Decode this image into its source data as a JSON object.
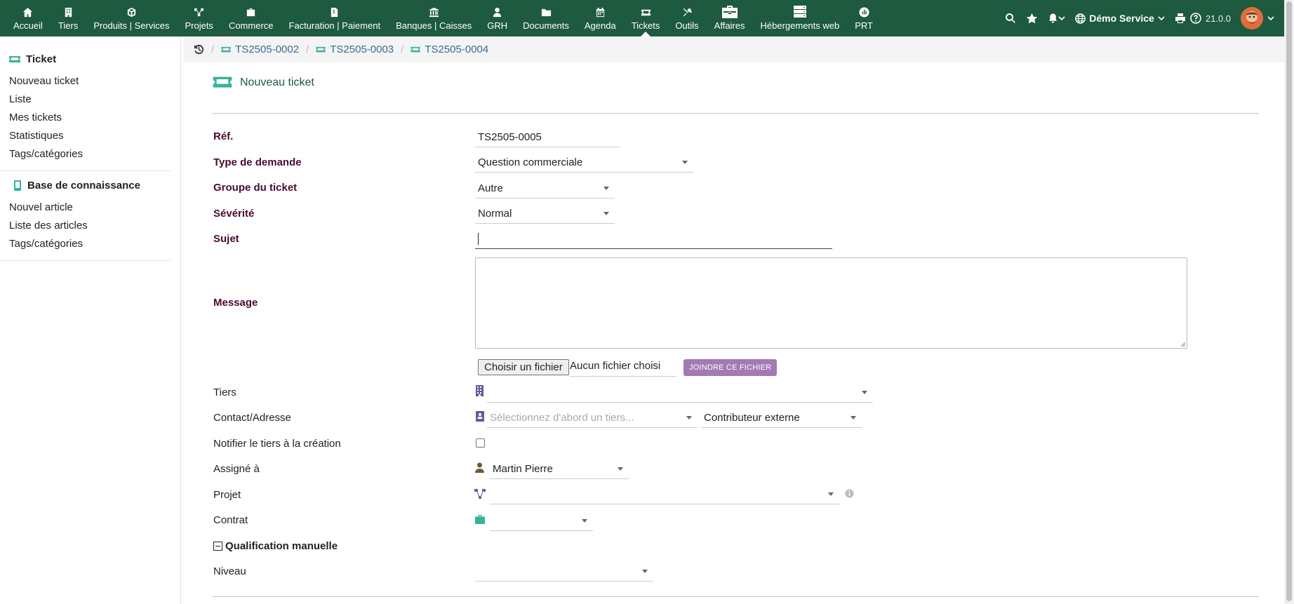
{
  "topbar": {
    "menu": [
      {
        "label": "Accueil",
        "icon": "home-icon"
      },
      {
        "label": "Tiers",
        "icon": "building-icon"
      },
      {
        "label": "Produits | Services",
        "icon": "cube-icon"
      },
      {
        "label": "Projets",
        "icon": "project-icon"
      },
      {
        "label": "Commerce",
        "icon": "briefcase-icon"
      },
      {
        "label": "Facturation | Paiement",
        "icon": "invoice-icon"
      },
      {
        "label": "Banques | Caisses",
        "icon": "bank-icon"
      },
      {
        "label": "GRH",
        "icon": "user-tie-icon"
      },
      {
        "label": "Documents",
        "icon": "folder-icon"
      },
      {
        "label": "Agenda",
        "icon": "calendar-icon"
      },
      {
        "label": "Tickets",
        "icon": "ticket-icon"
      },
      {
        "label": "Outils",
        "icon": "tools-icon"
      },
      {
        "label": "Affaires",
        "icon": "toolbox-icon"
      },
      {
        "label": "Hébergements web",
        "icon": "server-icon"
      },
      {
        "label": "PRT",
        "icon": "chart-circle-icon"
      }
    ],
    "active": "Tickets",
    "company": "Démo Service",
    "version": "21.0.0"
  },
  "breadcrumb": [
    "TS2505-0002",
    "TS2505-0003",
    "TS2505-0004"
  ],
  "sidebar": {
    "ticket_title": "Ticket",
    "ticket_links": [
      "Nouveau ticket",
      "Liste",
      "Mes tickets",
      "Statistiques",
      "Tags/catégories"
    ],
    "kb_title": "Base de connaissance",
    "kb_links": [
      "Nouvel article",
      "Liste des articles",
      "Tags/catégories"
    ]
  },
  "page": {
    "title": "Nouveau ticket"
  },
  "form": {
    "ref_label": "Réf.",
    "ref_value": "TS2505-0005",
    "type_label": "Type de demande",
    "type_value": "Question commerciale",
    "group_label": "Groupe du ticket",
    "group_value": "Autre",
    "severity_label": "Sévérité",
    "severity_value": "Normal",
    "subject_label": "Sujet",
    "subject_value": "",
    "message_label": "Message",
    "file_button": "Choisir un fichier",
    "file_status": "Aucun fichier choisi",
    "attach_button": "JOINDRE CE FICHIER",
    "tiers_label": "Tiers",
    "tiers_value": "",
    "contact_label": "Contact/Adresse",
    "contact_placeholder": "Sélectionnez d'abord un tiers...",
    "contact_role": "Contributeur externe",
    "notify_label": "Notifier le tiers à la création",
    "notify_checked": false,
    "assigned_label": "Assigné à",
    "assigned_value": "Martin Pierre",
    "project_label": "Projet",
    "contract_label": "Contrat",
    "qualification_label": "Qualification manuelle",
    "level_label": "Niveau"
  },
  "colors": {
    "topbar": "#1d5a3f",
    "accent": "#36b39a",
    "required_label": "#4a0a2f",
    "attach_button": "#a27ab4",
    "link": "#3a6b95"
  }
}
